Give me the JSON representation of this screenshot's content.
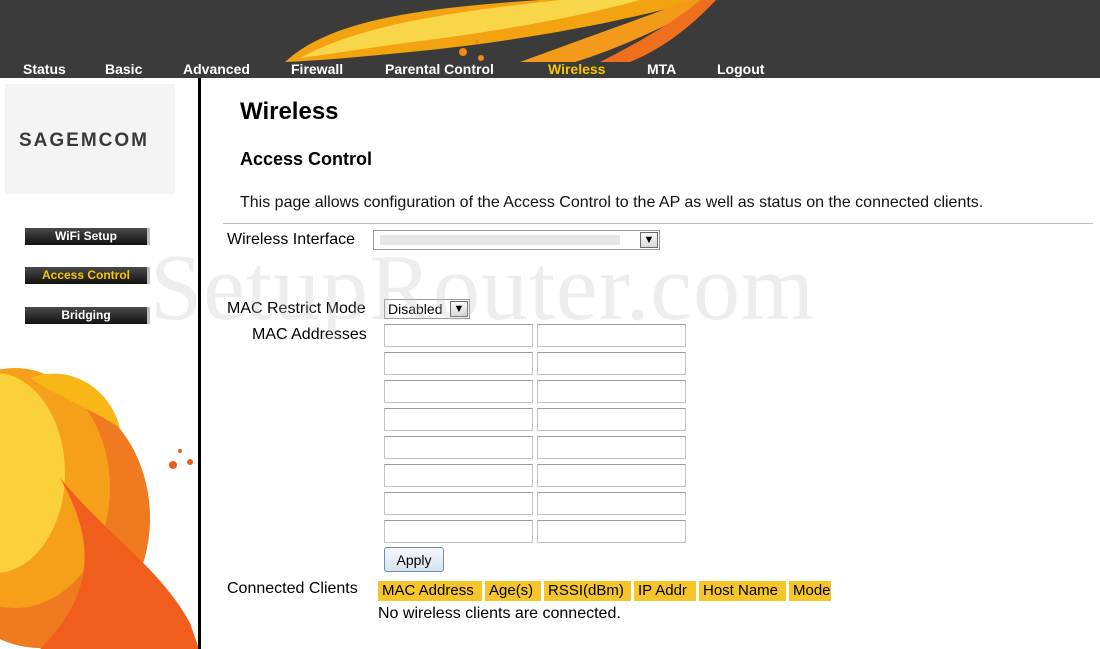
{
  "nav": {
    "items": [
      "Status",
      "Basic",
      "Advanced",
      "Firewall",
      "Parental Control",
      "Wireless",
      "MTA",
      "Logout"
    ],
    "active": "Wireless"
  },
  "sidebar": {
    "logo": "SAGEMCOM",
    "buttons": [
      "WiFi Setup",
      "Access Control",
      "Bridging"
    ],
    "active": "Access Control"
  },
  "page": {
    "title": "Wireless",
    "subtitle": "Access Control",
    "description": "This page allows configuration of the Access Control to the AP as well as status on the connected clients."
  },
  "form": {
    "wireless_interface_label": "Wireless Interface",
    "wireless_interface_value": "",
    "mac_restrict_label": "MAC Restrict Mode",
    "mac_restrict_value": "Disabled",
    "mac_addresses_label": "MAC Addresses",
    "mac_addresses": [
      "",
      "",
      "",
      "",
      "",
      "",
      "",
      "",
      "",
      "",
      "",
      "",
      "",
      "",
      "",
      ""
    ],
    "apply_label": "Apply"
  },
  "clients": {
    "label": "Connected Clients",
    "columns": [
      "MAC Address",
      "Age(s)",
      "RSSI(dBm)",
      "IP Addr",
      "Host Name",
      "Mode"
    ],
    "empty_message": "No wireless clients are connected."
  },
  "watermark": "SetupRouter.com",
  "colors": {
    "topbar": "#3b3b3b",
    "accent": "#f5c800",
    "header_cell": "#f5c52a"
  }
}
